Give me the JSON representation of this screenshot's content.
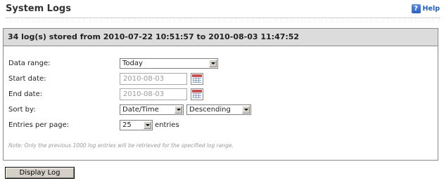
{
  "page": {
    "title": "System Logs",
    "help_label": "Help",
    "help_icon": "?"
  },
  "summary": {
    "text": "34 log(s) stored from 2010-07-22 10:51:57 to 2010-08-03 11:47:52"
  },
  "form": {
    "data_range": {
      "label": "Data range:",
      "value": "Today"
    },
    "start_date": {
      "label": "Start date:",
      "value": "2010-08-03"
    },
    "end_date": {
      "label": "End date:",
      "value": "2010-08-03"
    },
    "sort_by": {
      "label": "Sort by:",
      "field_value": "Date/Time",
      "order_value": "Descending"
    },
    "entries": {
      "label": "Entries per page:",
      "value": "25",
      "suffix": "entries"
    },
    "note": "Note: Only the previous 1000 log entries will be retrieved for the specified log range."
  },
  "actions": {
    "display_log": "Display Log"
  }
}
